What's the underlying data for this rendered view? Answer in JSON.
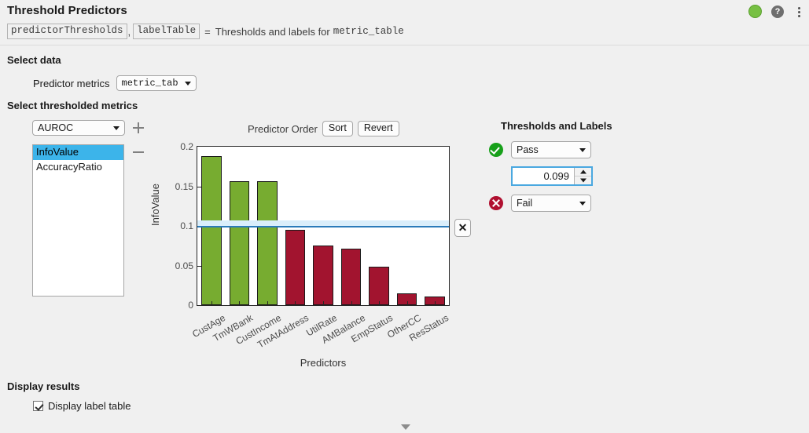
{
  "header": {
    "title": "Threshold Predictors",
    "output_var_1": "predictorThresholds",
    "comma": ",",
    "output_var_2": "labelTable",
    "equals": "=",
    "summary_text": "Thresholds and labels for",
    "summary_input": "metric_table",
    "status_icon": "green-status-dot",
    "help_icon": "?",
    "menu_icon": "kebab-menu-icon"
  },
  "select_data": {
    "heading": "Select data",
    "predictor_metrics_label": "Predictor metrics",
    "predictor_metrics_value": "metric_table",
    "predictor_metrics_options": [
      "metric_table"
    ]
  },
  "select_metrics": {
    "heading": "Select thresholded metrics",
    "metric_dropdown_value": "AUROC",
    "metric_dropdown_options": [
      "AUROC",
      "InfoValue",
      "AccuracyRatio"
    ],
    "add_button_label": "+",
    "remove_button_label": "−",
    "list_items": [
      {
        "label": "InfoValue",
        "selected": true
      },
      {
        "label": "AccuracyRatio",
        "selected": false
      }
    ]
  },
  "chart_panel": {
    "predictor_order_label": "Predictor Order",
    "sort_button": "Sort",
    "revert_button": "Revert",
    "delete_threshold_button": "✕"
  },
  "chart_data": {
    "type": "bar",
    "title": "",
    "xlabel": "Predictors",
    "ylabel": "InfoValue",
    "categories": [
      "CustAge",
      "TmWBank",
      "CustIncome",
      "TmAtAddress",
      "UtilRate",
      "AMBalance",
      "EmpStatus",
      "OtherCC",
      "ResStatus"
    ],
    "values": [
      0.1885,
      0.1568,
      0.156,
      0.0953,
      0.0752,
      0.0712,
      0.0482,
      0.0145,
      0.011
    ],
    "bar_colors": [
      "#77ac30",
      "#77ac30",
      "#77ac30",
      "#a2142f",
      "#a2142f",
      "#a2142f",
      "#a2142f",
      "#a2142f",
      "#a2142f"
    ],
    "ylim": [
      0,
      0.2
    ],
    "yticks": [
      0,
      0.05,
      0.1,
      0.15,
      0.2
    ],
    "ytick_labels": [
      "0",
      "0.05",
      "0.1",
      "0.15",
      "0.2"
    ],
    "grid": false,
    "legend": "none",
    "threshold_line": {
      "value": 0.099,
      "color": "#2b7bba",
      "band_color": "#daeefb"
    }
  },
  "thresholds_panel": {
    "title": "Thresholds and Labels",
    "pass_icon": "check-circle-icon",
    "pass_label": "Pass",
    "pass_options": [
      "Pass",
      "Fail"
    ],
    "threshold_value": "0.099",
    "fail_icon": "x-circle-icon",
    "fail_label": "Fail",
    "fail_options": [
      "Pass",
      "Fail"
    ]
  },
  "display_results": {
    "heading": "Display results",
    "checkbox_label": "Display label table",
    "checkbox_checked": true
  },
  "footer": {
    "collapse_icon": "chevron-down-icon"
  }
}
